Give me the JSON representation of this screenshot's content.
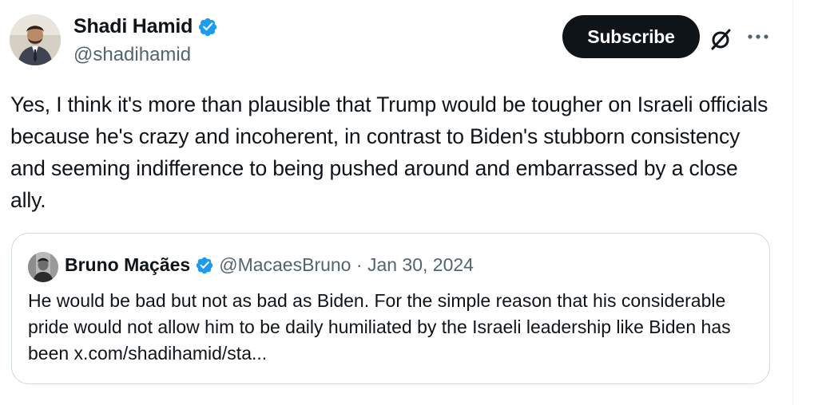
{
  "author": {
    "display_name": "Shadi Hamid",
    "handle": "@shadihamid"
  },
  "actions": {
    "subscribe_label": "Subscribe"
  },
  "tweet": {
    "text": "Yes, I think it's more than plausible that Trump would be tougher on Israeli officials because he's crazy and incoherent, in contrast to Biden's stubborn consistency and seeming indifference to being pushed around and embarrassed by a close ally."
  },
  "quoted_tweet": {
    "display_name": "Bruno Maçães",
    "handle": "@MacaesBruno",
    "separator": "·",
    "date": "Jan 30, 2024",
    "text": "He would be bad but not as bad as Biden. For the simple reason that his considerable pride would not allow him to be daily humiliated by the Israeli leadership like Biden has been x.com/shadihamid/sta..."
  },
  "icons": {
    "verified": "verified-badge-icon",
    "grok": "grok-icon",
    "more": "more-options-icon"
  },
  "colors": {
    "verified_blue": "#1d9bf0",
    "text_primary": "#0f1419",
    "text_secondary": "#536471",
    "border": "#cfd9de"
  }
}
